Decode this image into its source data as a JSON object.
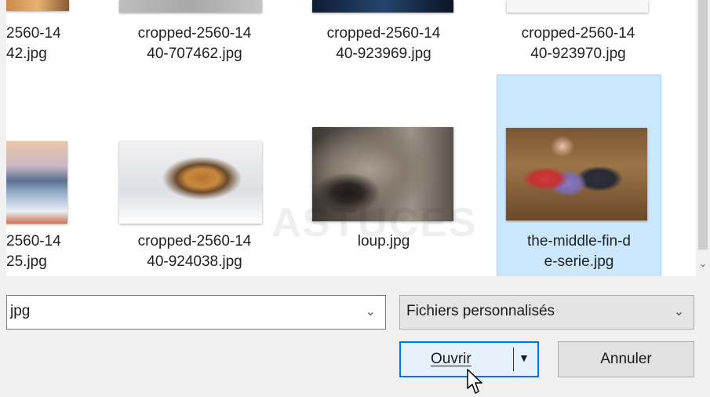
{
  "files": {
    "row1": [
      {
        "label_line1": "2560-14",
        "label_line2": "42.jpg"
      },
      {
        "label_line1": "cropped-2560-14",
        "label_line2": "40-707462.jpg"
      },
      {
        "label_line1": "cropped-2560-14",
        "label_line2": "40-923969.jpg"
      },
      {
        "label_line1": "cropped-2560-14",
        "label_line2": "40-923970.jpg"
      }
    ],
    "row2": [
      {
        "label_line1": "2560-14",
        "label_line2": "25.jpg"
      },
      {
        "label_line1": "cropped-2560-14",
        "label_line2": "40-924038.jpg"
      },
      {
        "label_line1": "loup.jpg",
        "label_line2": ""
      },
      {
        "label_line1": "the-middle-fin-d",
        "label_line2": "e-serie.jpg",
        "selected": true
      }
    ]
  },
  "filename_field": {
    "value": "jpg"
  },
  "filetype_select": {
    "value": "Fichiers personnalisés"
  },
  "buttons": {
    "open_label": "Ouvrir",
    "cancel_label": "Annuler"
  },
  "watermark": "ASTUCES",
  "colors": {
    "selection": "#cce8ff",
    "accent": "#0078d7"
  }
}
